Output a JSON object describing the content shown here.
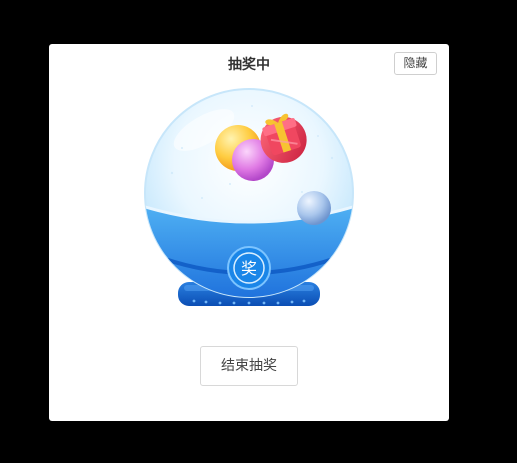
{
  "dialog": {
    "title": "抽奖中",
    "hide_label": "隐藏",
    "end_label": "结束抽奖",
    "badge_glyph": "奖"
  },
  "colors": {
    "overlay": "#000000",
    "panel": "#ffffff",
    "globe_light": "#dff3ff",
    "globe_blue": "#1e88e5",
    "globe_dark": "#0d5cc4",
    "ball_yellow": "#ffc94d",
    "ball_pink": "#e978e0",
    "ball_blue": "#a9c6ec",
    "gift_red": "#e8344e",
    "gift_gold": "#f5b81c"
  },
  "icons": [
    "gift-icon",
    "prize-badge-icon"
  ]
}
